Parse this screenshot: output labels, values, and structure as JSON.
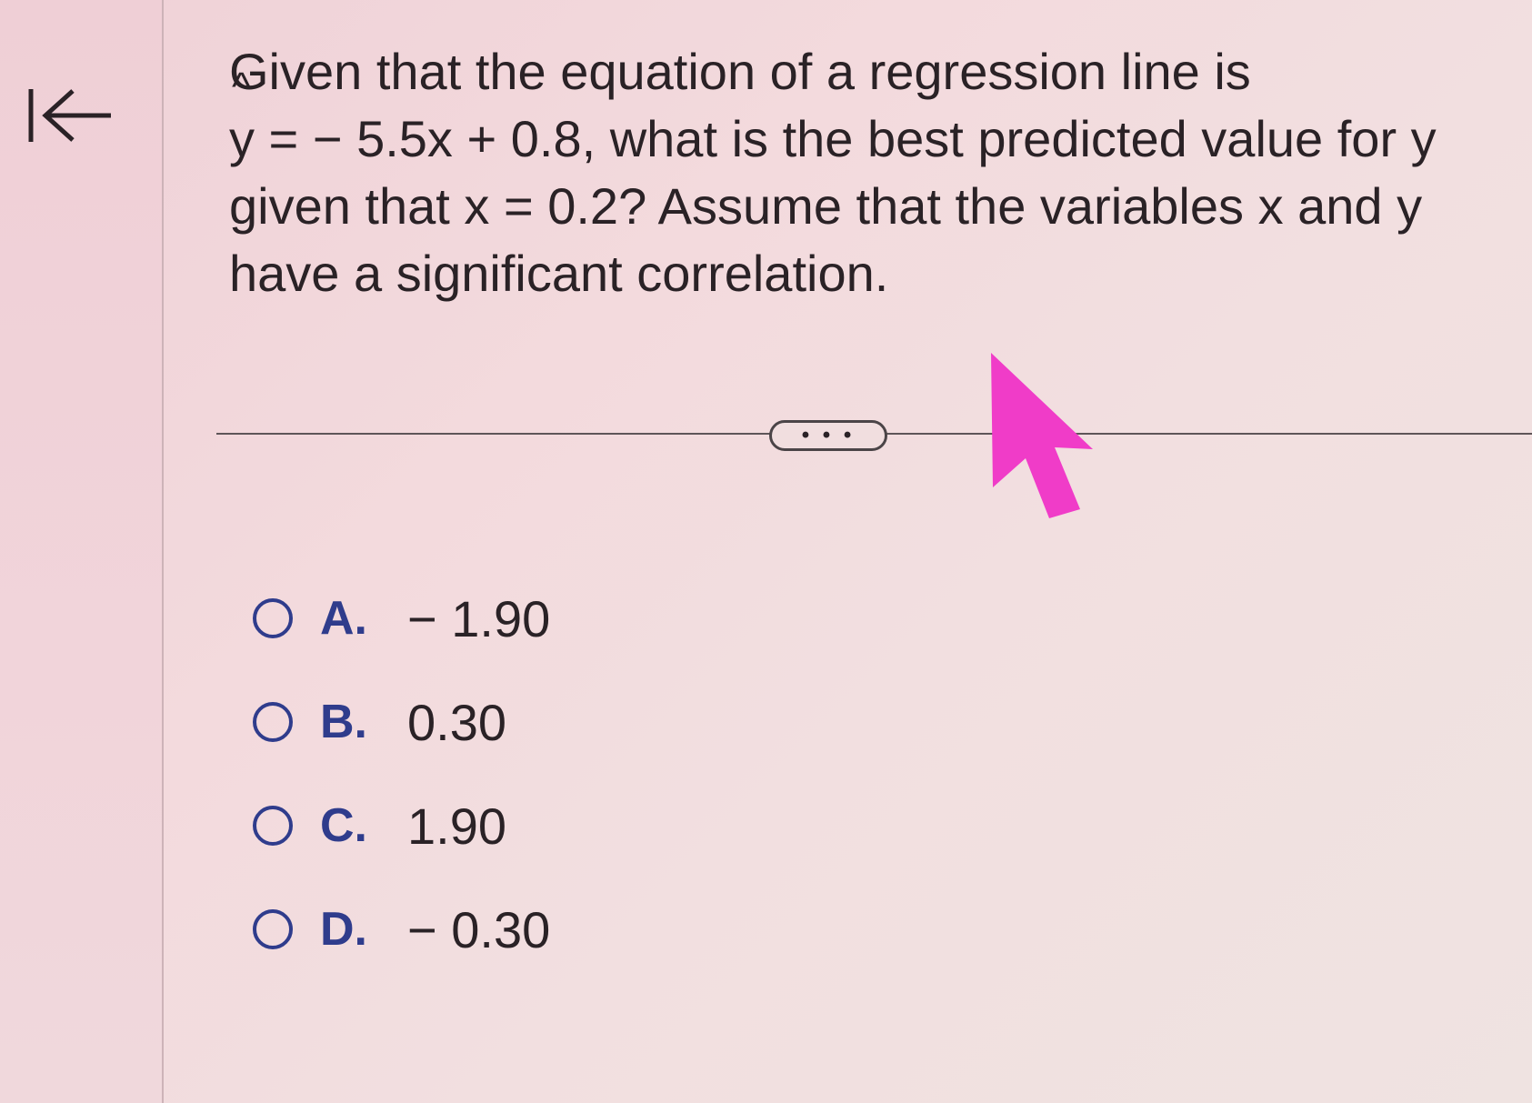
{
  "question": {
    "line1": "Given that the equation of a regression line is",
    "hat_symbol": "^",
    "y_symbol": "y",
    "line2_rest": " = − 5.5x + 0.8, what is the best predicted value for y",
    "line3": "given that x = 0.2? Assume that the variables x and y",
    "line4": "have a significant correlation."
  },
  "more_button": {
    "label": "• • •"
  },
  "options": [
    {
      "letter": "A.",
      "value": "− 1.90"
    },
    {
      "letter": "B.",
      "value": "0.30"
    },
    {
      "letter": "C.",
      "value": "1.90"
    },
    {
      "letter": "D.",
      "value": "− 0.30"
    }
  ],
  "icons": {
    "first_page": "first-page-arrow-icon",
    "cursor": "pointer-cursor-icon"
  },
  "colors": {
    "background": "#f2dadd",
    "option_letter": "#2f3c8c",
    "cursor": "#f03cc8"
  }
}
